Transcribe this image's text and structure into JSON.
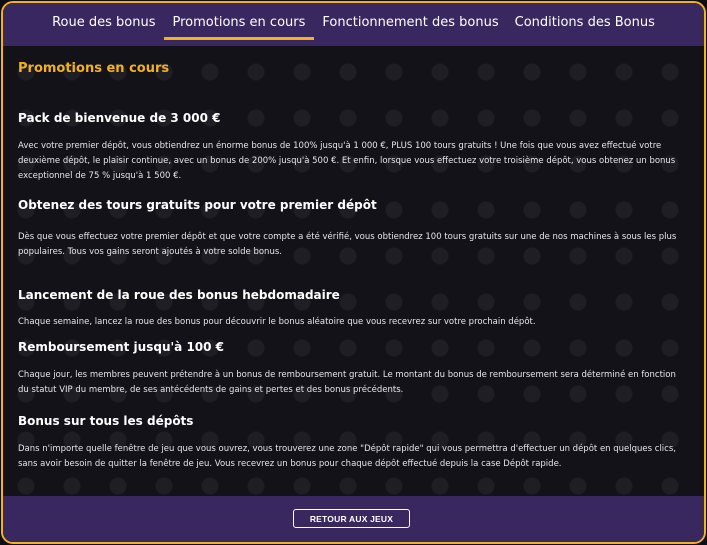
{
  "tabs": [
    {
      "label": "Roue des bonus"
    },
    {
      "label": "Promotions en cours"
    },
    {
      "label": "Fonctionnement des bonus"
    },
    {
      "label": "Conditions des Bonus"
    }
  ],
  "section_title": "Promotions en cours",
  "promotions": [
    {
      "title": "Pack de bienvenue de 3 000 €",
      "text": "Avec votre premier dépôt, vous obtiendrez un énorme bonus de 100% jusqu'à 1 000 €, PLUS 100 tours gratuits ! Une fois que vous avez effectué votre deuxième dépôt, le plaisir continue, avec un bonus de 200% jusqu'à 500 €. Et enfin, lorsque vous effectuez votre troisième dépôt, vous obtenez un bonus exceptionnel de 75 % jusqu'à 1 500 €."
    },
    {
      "title": "Obtenez des tours gratuits pour votre premier dépôt",
      "text": "Dès que vous effectuez votre premier dépôt et que votre compte a été vérifié, vous obtiendrez 100 tours gratuits sur une de nos machines à sous les plus populaires. Tous vos gains seront ajoutés à votre solde bonus."
    },
    {
      "title": "Lancement de la roue des bonus hebdomadaire",
      "text": "Chaque semaine, lancez la roue des bonus pour découvrir le bonus aléatoire que vous recevrez sur votre prochain dépôt."
    },
    {
      "title": "Remboursement jusqu'à 100 €",
      "text": "Chaque jour, les membres peuvent prétendre à un bonus de remboursement gratuit. Le montant du bonus de remboursement sera déterminé en fonction du statut VIP du membre, de ses antécédents de gains et pertes et des bonus précédents."
    },
    {
      "title": "Bonus sur tous les dépôts",
      "text": "Dans n'importe quelle fenêtre de jeu que vous ouvrez, vous trouverez une zone \"Dépôt rapide\" qui vous permettra d'effectuer un dépôt en quelques clics, sans avoir besoin de quitter la fenêtre de jeu. Vous recevrez un bonus pour chaque dépôt effectué depuis la case Dépôt rapide."
    }
  ],
  "footer": {
    "back_label": "RETOUR AUX JEUX"
  },
  "colors": {
    "accent": "#f2b21c",
    "header_bg": "#392760",
    "panel_bg": "#141219"
  }
}
